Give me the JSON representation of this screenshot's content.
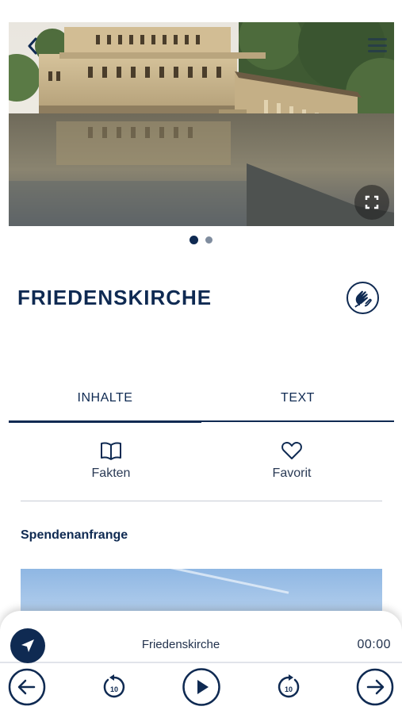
{
  "header": {
    "back_icon": "chevron-left-icon",
    "menu_icon": "hamburger-menu-icon",
    "fullscreen_icon": "fullscreen-icon"
  },
  "gallery": {
    "count": 2,
    "active_index": 0
  },
  "page": {
    "title": "FRIEDENSKIRCHE",
    "sign_language_icon": "sign-language-hands-icon"
  },
  "tabs": [
    {
      "label": "INHALTE",
      "active": true
    },
    {
      "label": "TEXT",
      "active": false
    }
  ],
  "actions": [
    {
      "label": "Fakten",
      "icon": "book-icon"
    },
    {
      "label": "Favorit",
      "icon": "heart-icon"
    }
  ],
  "section": {
    "label": "Spendenanfrange"
  },
  "player": {
    "title": "Friedenskirche",
    "time": "00:00",
    "nav_icon": "navigation-arrow-icon",
    "controls": [
      {
        "name": "previous",
        "icon": "arrow-left-circle-icon"
      },
      {
        "name": "rewind-10",
        "icon": "rewind-10-icon",
        "label": "10"
      },
      {
        "name": "play",
        "icon": "play-circle-icon"
      },
      {
        "name": "forward-10",
        "icon": "forward-10-icon",
        "label": "10"
      },
      {
        "name": "next",
        "icon": "arrow-right-circle-icon"
      }
    ]
  },
  "colors": {
    "primary": "#0f2a52",
    "divider": "#c8cdd6",
    "dot_inactive": "#7f8c9e"
  }
}
